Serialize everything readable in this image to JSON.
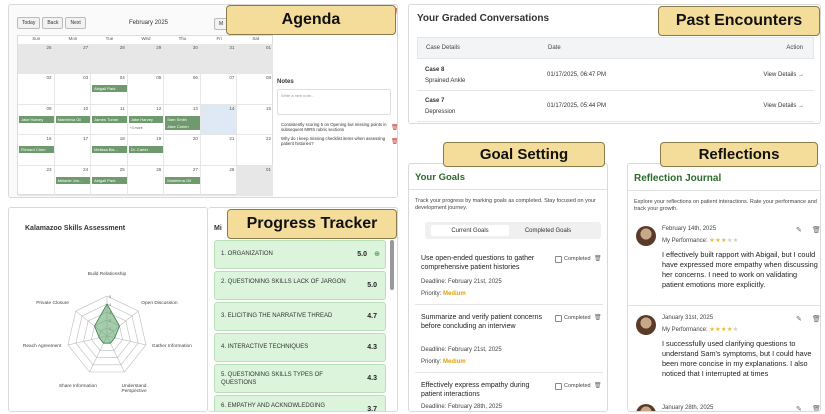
{
  "agenda": {
    "tag": "Agenda",
    "toolbar": {
      "today": "Today",
      "back": "Back",
      "next": "Next"
    },
    "month": "February 2025",
    "view_partial": "M",
    "dows": [
      "Sun",
      "Mon",
      "Tue",
      "Wed",
      "Thu",
      "Fri",
      "Sat"
    ],
    "weeks": [
      [
        "26",
        "27",
        "28",
        "29",
        "30",
        "31",
        "01"
      ],
      [
        "02",
        "03",
        "04",
        "05",
        "06",
        "07",
        "08"
      ],
      [
        "09",
        "10",
        "11",
        "12",
        "13",
        "14",
        "15"
      ],
      [
        "16",
        "17",
        "18",
        "19",
        "20",
        "21",
        "22"
      ],
      [
        "23",
        "24",
        "25",
        "26",
        "27",
        "28",
        "01"
      ]
    ],
    "events": {
      "e1": "Abigail Park",
      "e2": "Jake Harvey",
      "e3": "Marielena Gil",
      "e4": "James Turner",
      "e5": "Jake Harvey",
      "e6": "Sam Smith",
      "e7": "Jake Cohen",
      "e8": "Richard Chen",
      "e9": "Melissa Bis...",
      "e10": "Dr. Carter",
      "e11": "Melanie Jon...",
      "e12": "Abigail Park",
      "e13": "Marielena Gil"
    },
    "more": "+3 more",
    "checklist_item": "Review transcript for James Turner",
    "notes_title": "Notes",
    "notes_placeholder": "Write a new note...",
    "note1": "Consistently scoring 5 on Opening but missing points in subsequent MIRS rubric sections",
    "note2": "Why do I keep missing checklist items when assessing patient histories?"
  },
  "past": {
    "tag": "Past Encounters",
    "title": "Your Graded Conversations",
    "headers": {
      "case": "Case Details",
      "date": "Date",
      "action": "Action"
    },
    "rows": [
      {
        "case": "Case 8",
        "condition": "Sprained Ankle",
        "date": "01/17/2025, 06:47 PM",
        "action": "View Details"
      },
      {
        "case": "Case 7",
        "condition": "Depression",
        "date": "01/17/2025, 05:44 PM",
        "action": "View Details"
      }
    ]
  },
  "goals": {
    "tag": "Goal Setting",
    "title": "Your Goals",
    "desc": "Track your progress by marking goals as completed. Stay focused on your development journey.",
    "tabs": [
      "Current Goals",
      "Completed Goals"
    ],
    "deadline_label": "Deadline:",
    "priority_label": "Priority:",
    "completed_label": "Completed",
    "items": [
      {
        "text": "Use open-ended questions to gather comprehensive patient histories",
        "deadline": "February 21st, 2025",
        "priority": "Medium"
      },
      {
        "text": "Summarize and verify patient concerns before concluding an interview",
        "deadline": "February 21st, 2025",
        "priority": "Medium"
      },
      {
        "text": "Effectively express empathy during patient interactions",
        "deadline": "February 28th, 2025"
      }
    ]
  },
  "reflections": {
    "tag": "Reflections",
    "title": "Reflection Journal",
    "desc": "Explore your reflections on patient interactions. Rate your performance and track your growth.",
    "perf_label": "My Performance:",
    "entries": [
      {
        "date": "February 14th, 2025",
        "rating": 3,
        "text": "I effectively built rapport with Abigail, but I could have expressed more empathy when discussing her concerns. I need to work on validating patient emotions more explicitly."
      },
      {
        "date": "January 31st, 2025",
        "rating": 4,
        "text": "I successfully used clarifying questions to understand Sam's symptoms, but I could have been more concise in my explanations. I also noticed that I interrupted at times"
      },
      {
        "date": "January 28th, 2025"
      }
    ]
  },
  "kalamazoo": {
    "title": "Kalamazoo Skills Assessment",
    "axes": [
      "Build Relationship",
      "Open Discussion",
      "Gather Information",
      "Understand Perspective",
      "Share Information",
      "Reach Agreement",
      "Private Closure"
    ],
    "scale_labels": [
      "1",
      "2",
      "3",
      "4",
      "5"
    ],
    "scores": [
      4,
      2,
      1,
      1,
      1,
      1,
      2
    ],
    "fill_color": "#5aa36a"
  },
  "progress": {
    "tag": "Progress Tracker",
    "title_partial": "Mi",
    "items": [
      {
        "label": "1.  ORGANIZATION",
        "value": "5.0"
      },
      {
        "label": "2.  QUESTIONING SKILLS LACK OF JARGON",
        "value": "5.0"
      },
      {
        "label": "3.  ELICITING THE NARRATIVE THREAD",
        "value": "4.7"
      },
      {
        "label": "4.  INTERACTIVE TECHNIQUES",
        "value": "4.3"
      },
      {
        "label": "5.  QUESTIONING SKILLS TYPES OF QUESTIONS",
        "value": "4.3"
      },
      {
        "label": "6.  EMPATHY AND ACKNOWLEDGING PATIENT CUES",
        "value": "3.7"
      }
    ],
    "accent": "#dcf3dc"
  }
}
